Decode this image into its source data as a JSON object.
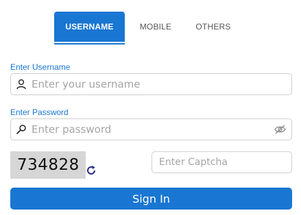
{
  "tabs": [
    {
      "label": "USERNAME",
      "active": true
    },
    {
      "label": "MOBILE",
      "active": false
    },
    {
      "label": "OTHERS",
      "active": false
    }
  ],
  "username": {
    "label": "Enter Username",
    "placeholder": "Enter your username",
    "value": "",
    "icon": "user-icon"
  },
  "password": {
    "label": "Enter Password",
    "placeholder": "Enter password",
    "value": "",
    "icon": "key-icon",
    "toggle_icon": "eye-slash-icon"
  },
  "captcha": {
    "code": "734828",
    "placeholder": "Enter Captcha",
    "value": "",
    "refresh_icon": "refresh-icon"
  },
  "signin": {
    "label": "Sign In"
  },
  "colors": {
    "accent": "#1976d2",
    "label": "#1976d2",
    "captcha_bg": "#d6d6d6",
    "refresh": "#2a2a8a"
  }
}
